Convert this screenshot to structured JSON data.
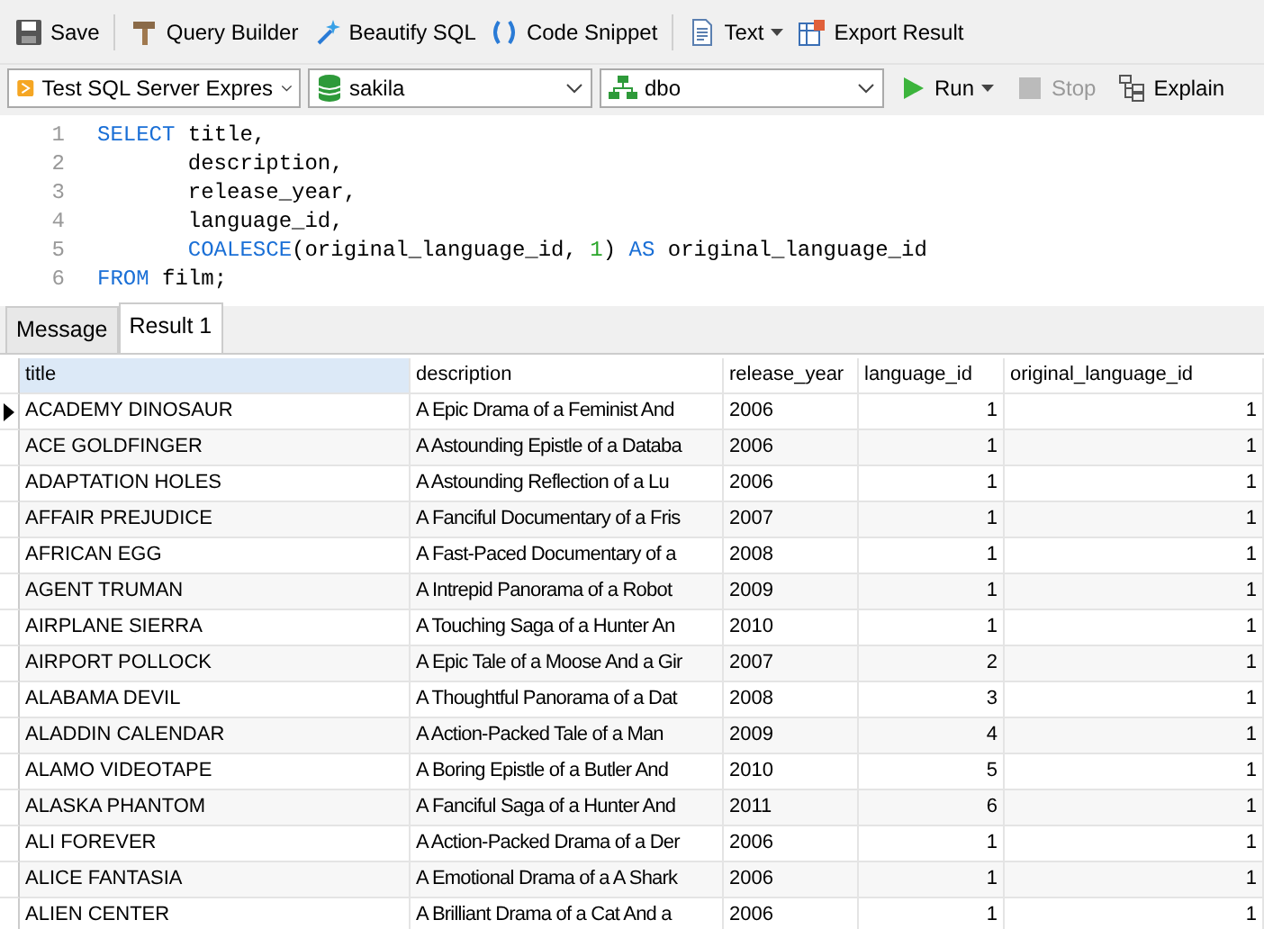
{
  "toolbar": [
    {
      "label": "Save",
      "dropdown": false
    },
    {
      "label": "Query Builder",
      "dropdown": false
    },
    {
      "label": "Beautify SQL",
      "dropdown": false
    },
    {
      "label": "Code Snippet",
      "dropdown": false
    },
    {
      "label": "Text",
      "dropdown": true
    },
    {
      "label": "Export Result",
      "dropdown": false
    }
  ],
  "connection": {
    "server": "Test SQL Server Expres",
    "database": "sakila",
    "schema": "dbo"
  },
  "actions": [
    {
      "label": "Run",
      "dropdown": true,
      "disabled": false
    },
    {
      "label": "Stop",
      "dropdown": false,
      "disabled": true
    },
    {
      "label": "Explain",
      "dropdown": false,
      "disabled": false
    }
  ],
  "editor": {
    "lines": [
      {
        "number": "1",
        "tokens": [
          {
            "text": "SELECT",
            "kind": "keyword"
          },
          {
            "text": " title,",
            "kind": "ident"
          }
        ]
      },
      {
        "number": "2",
        "tokens": [
          {
            "text": "       description,",
            "kind": "ident"
          }
        ]
      },
      {
        "number": "3",
        "tokens": [
          {
            "text": "       release_year,",
            "kind": "ident"
          }
        ]
      },
      {
        "number": "4",
        "tokens": [
          {
            "text": "       language_id,",
            "kind": "ident"
          }
        ]
      },
      {
        "number": "5",
        "tokens": [
          {
            "text": "       COALESCE",
            "kind": "keyword"
          },
          {
            "text": "(original_language_id, ",
            "kind": "ident"
          },
          {
            "text": "1",
            "kind": "number"
          },
          {
            "text": ") ",
            "kind": "ident"
          },
          {
            "text": "AS",
            "kind": "keyword"
          },
          {
            "text": " original_language_id",
            "kind": "ident"
          }
        ]
      },
      {
        "number": "6",
        "tokens": [
          {
            "text": "FROM",
            "kind": "keyword"
          },
          {
            "text": " film;",
            "kind": "ident"
          }
        ]
      }
    ]
  },
  "result_tabs": [
    {
      "label": "Message",
      "selected": false
    },
    {
      "label": "Result 1",
      "selected": true
    }
  ],
  "table": {
    "columns": [
      {
        "label": "title",
        "selected": true
      },
      {
        "label": "description",
        "selected": false
      },
      {
        "label": "release_year",
        "selected": false
      },
      {
        "label": "language_id",
        "selected": false
      },
      {
        "label": "original_language_id",
        "selected": false
      }
    ],
    "rows": [
      {
        "current": true,
        "cells": [
          "ACADEMY DINOSAUR",
          "A Epic Drama of a Feminist And",
          "2006",
          "1",
          "1"
        ]
      },
      {
        "current": false,
        "cells": [
          "ACE GOLDFINGER",
          "A Astounding Epistle of a Databa",
          "2006",
          "1",
          "1"
        ]
      },
      {
        "current": false,
        "cells": [
          "ADAPTATION HOLES",
          "A Astounding Reflection of a Lu",
          "2006",
          "1",
          "1"
        ]
      },
      {
        "current": false,
        "cells": [
          "AFFAIR PREJUDICE",
          "A Fanciful Documentary of a Fris",
          "2007",
          "1",
          "1"
        ]
      },
      {
        "current": false,
        "cells": [
          "AFRICAN EGG",
          "A Fast-Paced Documentary of a",
          "2008",
          "1",
          "1"
        ]
      },
      {
        "current": false,
        "cells": [
          "AGENT TRUMAN",
          "A Intrepid Panorama of a Robot",
          "2009",
          "1",
          "1"
        ]
      },
      {
        "current": false,
        "cells": [
          "AIRPLANE SIERRA",
          "A Touching Saga of a Hunter An",
          "2010",
          "1",
          "1"
        ]
      },
      {
        "current": false,
        "cells": [
          "AIRPORT POLLOCK",
          "A Epic Tale of a Moose And a Gir",
          "2007",
          "2",
          "1"
        ]
      },
      {
        "current": false,
        "cells": [
          "ALABAMA DEVIL",
          "A Thoughtful Panorama of a Dat",
          "2008",
          "3",
          "1"
        ]
      },
      {
        "current": false,
        "cells": [
          "ALADDIN CALENDAR",
          "A Action-Packed Tale of a Man",
          "2009",
          "4",
          "1"
        ]
      },
      {
        "current": false,
        "cells": [
          "ALAMO VIDEOTAPE",
          "A Boring Epistle of a Butler And",
          "2010",
          "5",
          "1"
        ]
      },
      {
        "current": false,
        "cells": [
          "ALASKA PHANTOM",
          "A Fanciful Saga of a Hunter And",
          "2011",
          "6",
          "1"
        ]
      },
      {
        "current": false,
        "cells": [
          "ALI FOREVER",
          "A Action-Packed Drama of a Der",
          "2006",
          "1",
          "1"
        ]
      },
      {
        "current": false,
        "cells": [
          "ALICE FANTASIA",
          "A Emotional Drama of a A Shark",
          "2006",
          "1",
          "1"
        ]
      },
      {
        "current": false,
        "cells": [
          "ALIEN CENTER",
          "A Brilliant Drama of a Cat And a",
          "2006",
          "1",
          "1"
        ]
      }
    ]
  }
}
